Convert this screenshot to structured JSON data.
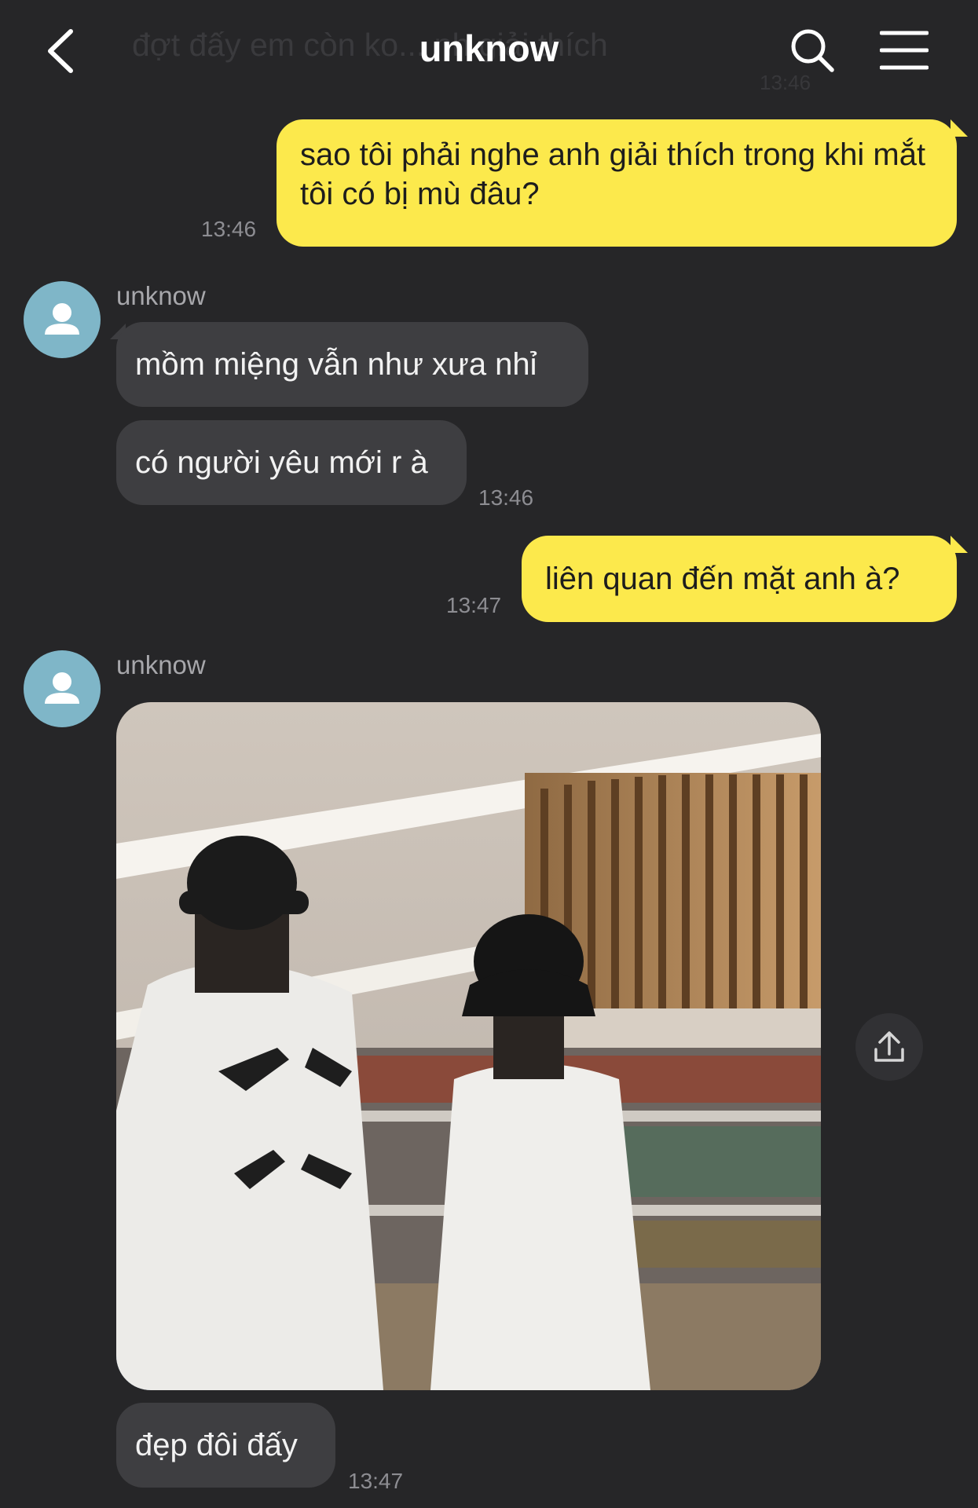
{
  "header": {
    "ghost_message": "đợt đấy em còn ko... nh giải thích",
    "ghost_time": "13:46",
    "title": "unknow"
  },
  "messages": [
    {
      "sender": "me",
      "text": "sao tôi phải nghe anh giải thích trong khi mắt tôi có bị mù đâu?",
      "time": "13:46"
    },
    {
      "sender": "unknow",
      "text": "mồm miệng vẫn như xưa nhỉ"
    },
    {
      "sender": "unknow",
      "text": "có người yêu mới r à",
      "time": "13:46"
    },
    {
      "sender": "me",
      "text": "liên quan đến mặt anh à?",
      "time": "13:47"
    },
    {
      "sender": "unknow",
      "type": "image"
    },
    {
      "sender": "unknow",
      "text": "đẹp đôi đấy",
      "time": "13:47"
    }
  ],
  "sender_name": "unknow",
  "icons": {
    "back": "back-chevron-icon",
    "search": "search-icon",
    "menu": "hamburger-menu-icon",
    "avatar": "person-icon",
    "share": "share-icon"
  },
  "colors": {
    "background": "#262628",
    "my_bubble": "#fce94c",
    "their_bubble": "#3e3e41",
    "avatar": "#7fb6c8"
  }
}
